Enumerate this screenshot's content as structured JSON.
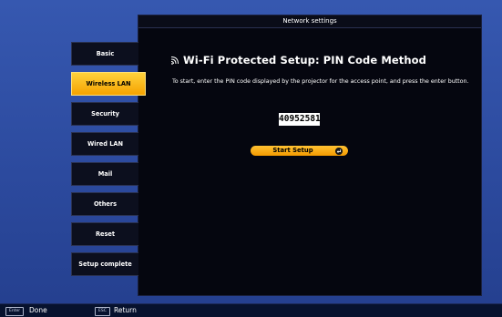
{
  "window": {
    "title": "Network settings"
  },
  "sidebar": {
    "items": [
      {
        "label": "Basic",
        "active": false
      },
      {
        "label": "Wireless LAN",
        "active": true
      },
      {
        "label": "Security",
        "active": false
      },
      {
        "label": "Wired LAN",
        "active": false
      },
      {
        "label": "Mail",
        "active": false
      },
      {
        "label": "Others",
        "active": false
      },
      {
        "label": "Reset",
        "active": false
      },
      {
        "label": "Setup complete",
        "active": false
      }
    ]
  },
  "main": {
    "heading": "Wi-Fi Protected Setup: PIN Code Method",
    "heading_icon": "wifi-signal-icon",
    "instruction": "To start, enter the PIN code displayed by the projector for the access point, and press the enter button.",
    "pin_code": "40952581",
    "start_button_label": "Start Setup",
    "start_button_icon": "enter-icon"
  },
  "footer": {
    "enter_key": "Enter",
    "enter_action": "Done",
    "esc_key": "ESC",
    "esc_action": "Return"
  },
  "colors": {
    "background": "#2f4fa3",
    "panel": "#05060f",
    "accent": "#f5a200",
    "text": "#ffffff"
  }
}
